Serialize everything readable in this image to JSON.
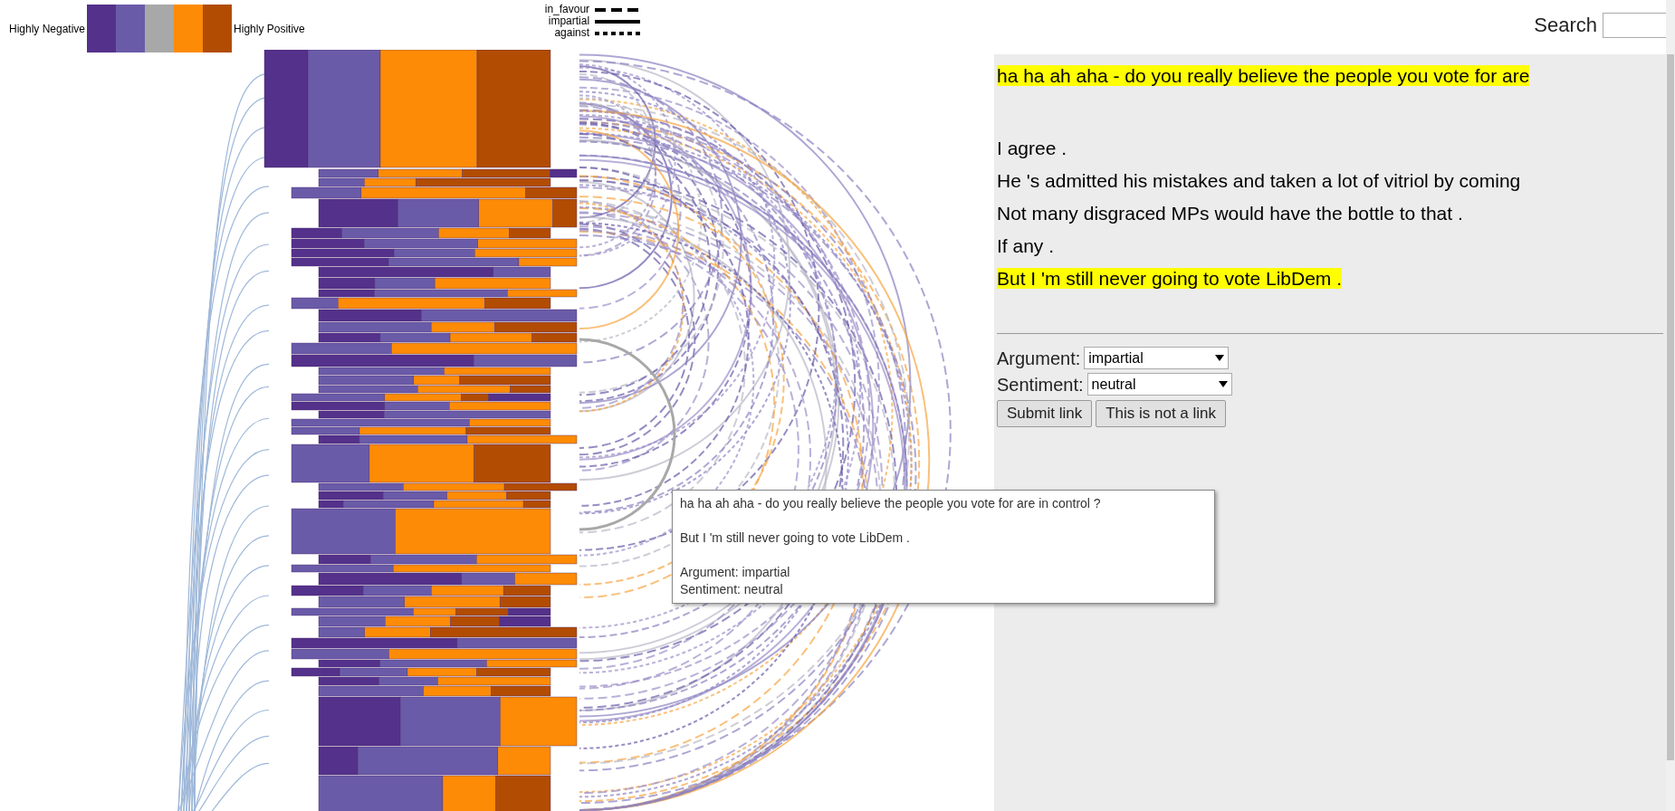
{
  "legend": {
    "low_label": "Highly Negative",
    "high_label": "Highly Positive",
    "swatches": [
      {
        "color": "#54318a"
      },
      {
        "color": "#6a5ba8"
      },
      {
        "color": "#a8a8a8"
      },
      {
        "color": "#fd8b05"
      },
      {
        "color": "#b24c03"
      }
    ]
  },
  "line_legend": [
    {
      "label": "in_favour",
      "kind": "long-dash"
    },
    {
      "label": "impartial",
      "kind": "solid"
    },
    {
      "label": "against",
      "kind": "short-dash"
    }
  ],
  "search": {
    "label": "Search"
  },
  "post": {
    "quote": {
      "text": "ha ha ah aha - do you really believe the people you vote for are",
      "highlighted": true
    },
    "lines": [
      {
        "text": "I agree .",
        "highlighted": false
      },
      {
        "text": "He 's admitted his mistakes and taken a lot of vitriol by coming",
        "highlighted": false
      },
      {
        "text": "Not many disgraced MPs would have the bottle to that .",
        "highlighted": false
      },
      {
        "text": "If any .",
        "highlighted": false
      },
      {
        "text": "But I 'm still never going to vote LibDem .",
        "highlighted": true
      }
    ]
  },
  "form": {
    "fields": [
      {
        "label": "Argument:",
        "value": "impartial"
      },
      {
        "label": "Sentiment:",
        "value": "neutral"
      }
    ],
    "buttons": [
      "Submit link",
      "This is not a link"
    ]
  },
  "tooltip": {
    "quote": "ha ha ah aha - do you really believe the people you vote for are in control ?",
    "reply": "But I 'm still never going to vote LibDem .",
    "argument": "Argument: impartial",
    "sentiment": "Sentiment: neutral"
  }
}
